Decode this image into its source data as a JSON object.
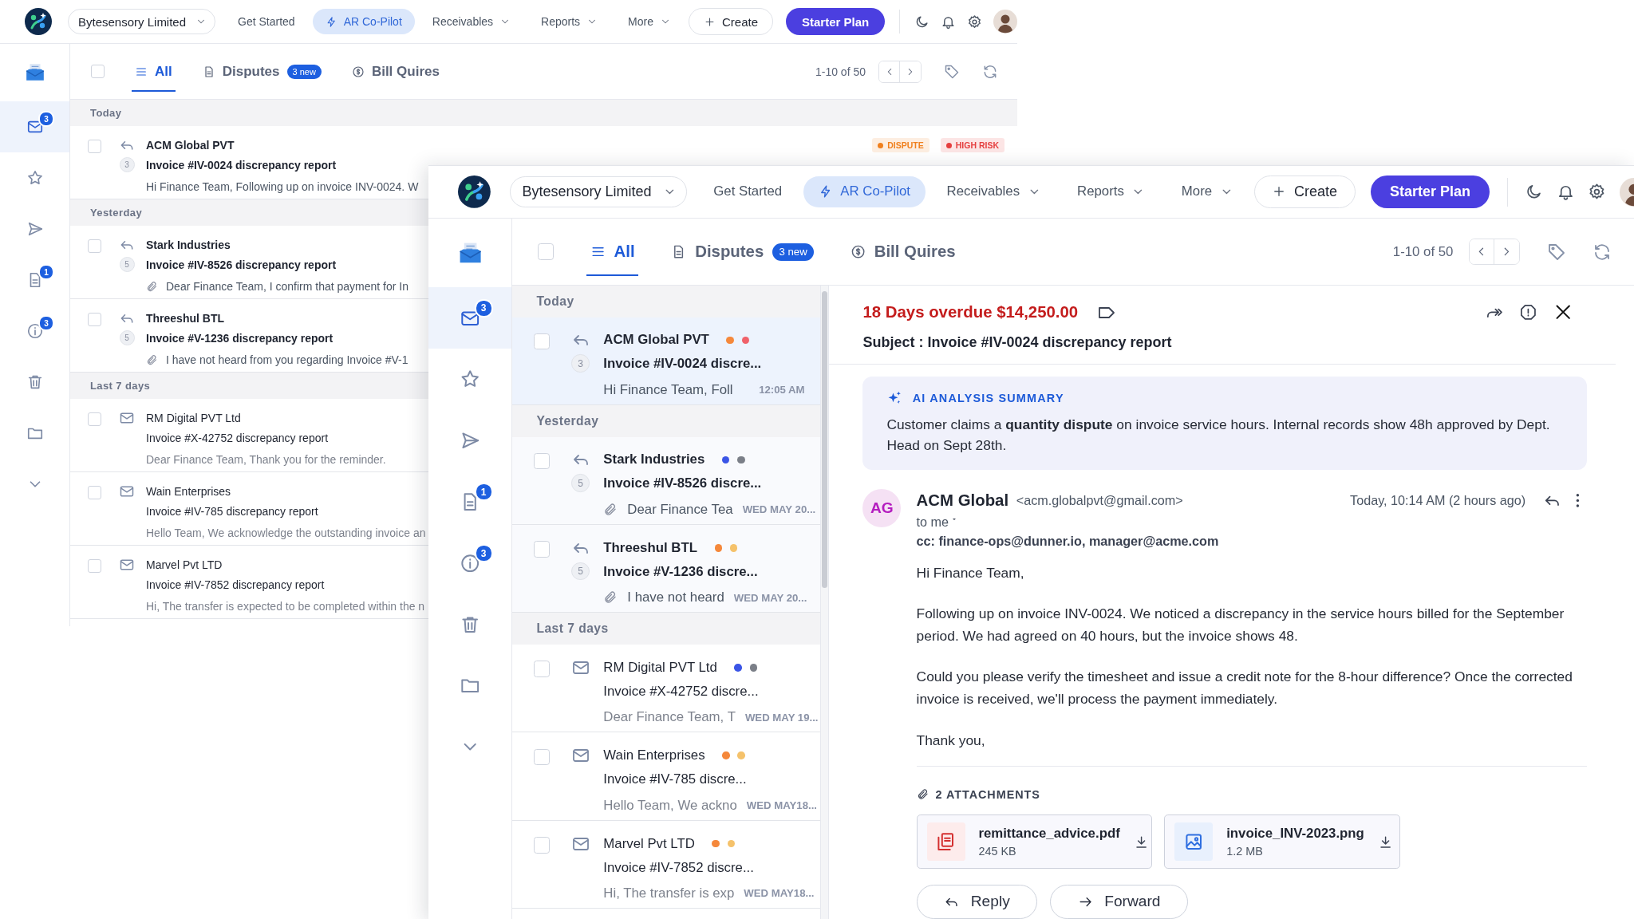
{
  "back_window": {
    "top_bar": {
      "company": "Bytesensory Limited",
      "nav": [
        {
          "label": "Get Started",
          "kind": "link",
          "selected": false
        },
        {
          "label": "AR Co-Pilot",
          "kind": "copilot",
          "selected": true
        },
        {
          "label": "Receivables",
          "kind": "menu",
          "selected": false
        },
        {
          "label": "Reports",
          "kind": "menu",
          "selected": false
        },
        {
          "label": "More",
          "kind": "menu",
          "selected": false
        }
      ],
      "create": "Create",
      "plan": "Starter Plan"
    },
    "sidebar": {
      "items": [
        {
          "kind": "inbox",
          "selected": false
        },
        {
          "kind": "mail",
          "badge": "3",
          "selected": true
        },
        {
          "kind": "star",
          "selected": false
        },
        {
          "kind": "send",
          "selected": false
        },
        {
          "kind": "document",
          "badge": "1",
          "selected": false
        },
        {
          "kind": "info",
          "badge": "3",
          "selected": false
        },
        {
          "kind": "trash",
          "selected": false
        },
        {
          "kind": "folder",
          "selected": false
        },
        {
          "kind": "more",
          "selected": false
        }
      ]
    },
    "toolbar": {
      "select_all_checked": false,
      "tabs": [
        {
          "label": "All",
          "kind": "all",
          "selected": true
        },
        {
          "label": "Disputes",
          "kind": "disputes",
          "badge": "3 new",
          "selected": false
        },
        {
          "label": "Bill Quires",
          "kind": "bills",
          "selected": false
        }
      ],
      "pagination": "1-10 of 50"
    },
    "mail_list": {
      "groups": [
        {
          "label": "Today",
          "rows": [
            {
              "sender": "ACM Global PVT",
              "subject": "Invoice #IV-0024 discrepancy report",
              "preview": "Hi Finance Team, Following up on invoice INV-0024. W",
              "kind": "reply",
              "replies": "3",
              "attachment": false,
              "unread": true,
              "checked": false,
              "tags": [
                {
                  "label": "DISPUTE",
                  "color": "#f0801e"
                },
                {
                  "label": "HIGH RISK",
                  "color": "#e53e3e"
                }
              ]
            }
          ]
        },
        {
          "label": "Yesterday",
          "rows": [
            {
              "sender": "Stark Industries",
              "subject": "Invoice #IV-8526 discrepancy report",
              "preview": "Dear Finance Team, I confirm that payment for In",
              "kind": "reply",
              "replies": "5",
              "attachment": true,
              "unread": true,
              "checked": false
            },
            {
              "sender": "Threeshul BTL",
              "subject": "Invoice #V-1236 discrepancy report",
              "preview": "I have not heard from you regarding Invoice #V-1",
              "kind": "reply",
              "replies": "5",
              "attachment": true,
              "unread": true,
              "checked": false
            }
          ]
        },
        {
          "label": "Last 7 days",
          "rows": [
            {
              "sender": "RM Digital PVT Ltd",
              "subject": "Invoice #X-42752 discrepancy report",
              "preview": "Dear Finance Team, Thank you for the reminder.",
              "kind": "mail",
              "attachment": false,
              "unread": false,
              "checked": false
            },
            {
              "sender": "Wain Enterprises",
              "subject": "Invoice #IV-785 discrepancy report",
              "preview": "Hello Team, We acknowledge the outstanding invoice an",
              "kind": "mail",
              "attachment": false,
              "unread": false,
              "checked": false
            },
            {
              "sender": "Marvel Pvt LTD",
              "subject": "Invoice #IV-7852 discrepancy report",
              "preview": "Hi, The transfer is expected to be completed within the n",
              "kind": "mail",
              "attachment": false,
              "unread": false,
              "checked": false
            }
          ]
        }
      ]
    }
  },
  "front_window": {
    "top_bar": {
      "company": "Bytesensory Limited",
      "nav": [
        {
          "label": "Get Started",
          "kind": "link",
          "selected": false
        },
        {
          "label": "AR Co-Pilot",
          "kind": "copilot",
          "selected": true
        },
        {
          "label": "Receivables",
          "kind": "menu",
          "selected": false
        },
        {
          "label": "Reports",
          "kind": "menu",
          "selected": false
        },
        {
          "label": "More",
          "kind": "menu",
          "selected": false
        }
      ],
      "create": "Create",
      "plan": "Starter Plan"
    },
    "sidebar": {
      "items": [
        {
          "kind": "inbox",
          "selected": false
        },
        {
          "kind": "mail",
          "badge": "3",
          "selected": true
        },
        {
          "kind": "star",
          "selected": false
        },
        {
          "kind": "send",
          "selected": false
        },
        {
          "kind": "document",
          "badge": "1",
          "selected": false
        },
        {
          "kind": "info",
          "badge": "3",
          "selected": false
        },
        {
          "kind": "trash",
          "selected": false
        },
        {
          "kind": "folder",
          "selected": false
        },
        {
          "kind": "more",
          "selected": false
        }
      ]
    },
    "toolbar": {
      "select_all_checked": false,
      "tabs": [
        {
          "label": "All",
          "kind": "all",
          "selected": true
        },
        {
          "label": "Disputes",
          "kind": "disputes",
          "badge": "3 new",
          "selected": false
        },
        {
          "label": "Bill Quires",
          "kind": "bills",
          "selected": false
        }
      ],
      "pagination": "1-10 of 50"
    },
    "mail_list": {
      "groups": [
        {
          "label": "Today",
          "rows": [
            {
              "sender": "ACM Global PVT",
              "dots": [
                {
                  "color": "#f5883b"
                },
                {
                  "color": "#f0616a"
                }
              ],
              "subject": "Invoice #IV-0024 discre...",
              "preview": "Hi Finance Team, Foll",
              "time": "12:05 AM",
              "kind": "reply",
              "replies": "3",
              "attachment": false,
              "unread": true,
              "checked": false,
              "selected": true
            }
          ]
        },
        {
          "label": "Yesterday",
          "rows": [
            {
              "sender": "Stark Industries",
              "dots": [
                {
                  "color": "#3b55e6"
                },
                {
                  "color": "#7b7f88"
                }
              ],
              "subject": "Invoice #IV-8526 discre...",
              "preview": "Dear Finance Tea",
              "time": "WED MAY 20...",
              "kind": "reply",
              "replies": "5",
              "attachment": true,
              "unread": true,
              "checked": false,
              "selected": false
            },
            {
              "sender": "Threeshul BTL",
              "dots": [
                {
                  "color": "#f5883b"
                },
                {
                  "color": "#f5c26b"
                }
              ],
              "subject": "Invoice #V-1236 discre...",
              "preview": "I have not heard",
              "time": "WED MAY 20...",
              "kind": "reply",
              "replies": "5",
              "attachment": true,
              "unread": true,
              "checked": false,
              "selected": false
            }
          ]
        },
        {
          "label": "Last 7 days",
          "rows": [
            {
              "sender": "RM Digital PVT Ltd",
              "dots": [
                {
                  "color": "#3b55e6"
                },
                {
                  "color": "#7b7f88"
                }
              ],
              "subject": "Invoice #X-42752 discre...",
              "preview": "Dear Finance Team, T",
              "time": "WED MAY 19...",
              "kind": "mail",
              "attachment": false,
              "unread": false,
              "checked": false,
              "selected": false
            },
            {
              "sender": "Wain Enterprises",
              "dots": [
                {
                  "color": "#f5883b"
                },
                {
                  "color": "#f5c26b"
                }
              ],
              "subject": "Invoice #IV-785 discre...",
              "preview": "Hello Team, We ackno",
              "time": "WED MAY18...",
              "kind": "mail",
              "attachment": false,
              "unread": false,
              "checked": false,
              "selected": false
            },
            {
              "sender": "Marvel Pvt LTD",
              "dots": [
                {
                  "color": "#f5883b"
                },
                {
                  "color": "#f5c26b"
                }
              ],
              "subject": "Invoice #IV-7852 discre...",
              "preview": "Hi, The transfer is exp",
              "time": "WED MAY18...",
              "kind": "mail",
              "attachment": false,
              "unread": false,
              "checked": false,
              "selected": false
            }
          ]
        }
      ]
    },
    "message": {
      "overdue": "18 Days overdue $14,250.00",
      "subject": "Subject : Invoice #IV-0024 discrepancy report",
      "summary": {
        "title": "AI ANALYSIS SUMMARY",
        "text": "Customer claims a **quantity dispute** on invoice service hours. Internal records show 48h approved by Dept. Head on Sept 28th."
      },
      "sender": {
        "initials": "AG",
        "name": "ACM Global",
        "email": "<acm.globalpvt@gmail.com>",
        "time": "Today, 10:14 AM (2 hours ago)",
        "to": "to me",
        "cc": "cc: finance-ops@dunner.io, manager@acme.com"
      },
      "body": [
        "Hi Finance Team,",
        "Following up on invoice INV-0024. We noticed a discrepancy in the service hours billed for the September period. We had agreed on 40 hours, but the invoice shows 48.",
        "Could you please verify the timesheet and issue a credit note for the 8-hour difference? Once the corrected invoice is received, we'll process the payment immediately.",
        "Thank you,"
      ],
      "attachments": {
        "title": "2 ATTACHMENTS",
        "files": [
          {
            "name": "remittance_advice.pdf",
            "size": "245 KB",
            "kind": "pdf"
          },
          {
            "name": "invoice_INV-2023.png",
            "size": "1.2 MB",
            "kind": "image"
          }
        ]
      },
      "actions": [
        {
          "label": "Reply",
          "kind": "reply"
        },
        {
          "label": "Forward",
          "kind": "forward"
        }
      ]
    }
  }
}
